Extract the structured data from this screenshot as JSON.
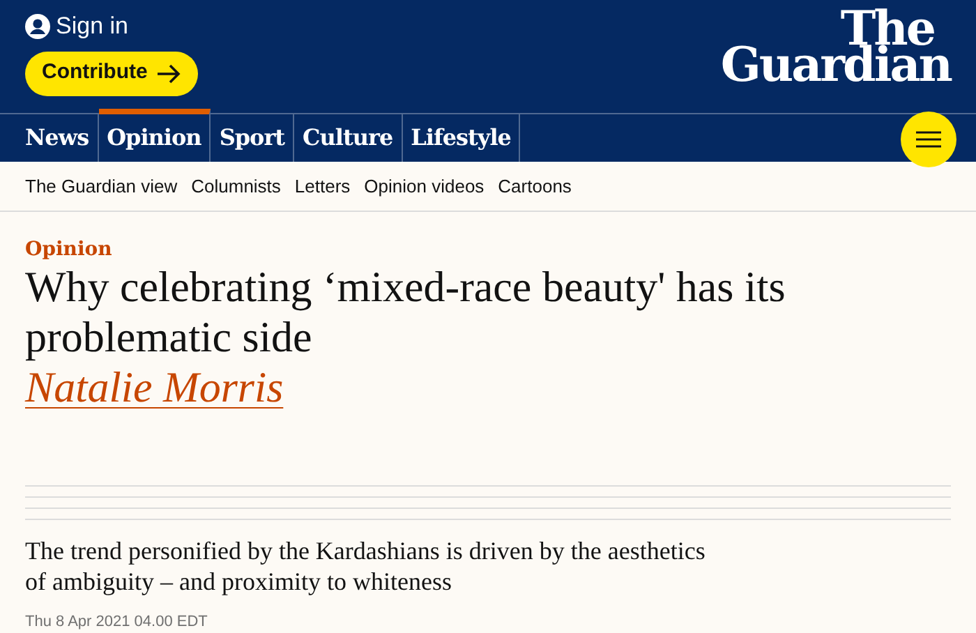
{
  "header": {
    "sign_in": "Sign in",
    "contribute": "Contribute",
    "logo": [
      "The",
      "Guardian"
    ]
  },
  "nav": [
    {
      "label": "News",
      "selected": false
    },
    {
      "label": "Opinion",
      "selected": true
    },
    {
      "label": "Sport",
      "selected": false
    },
    {
      "label": "Culture",
      "selected": false
    },
    {
      "label": "Lifestyle",
      "selected": false
    }
  ],
  "subnav": [
    "The Guardian view",
    "Columnists",
    "Letters",
    "Opinion videos",
    "Cartoons"
  ],
  "article": {
    "section": "Opinion",
    "headline": "Why celebrating ‘mixed-race beauty' has its problematic side",
    "byline": "Natalie Morris",
    "standfirst": "The trend personified by the Kardashians is driven by the aesthetics of ambiguity – and proximity to whiteness",
    "date": "Thu 8 Apr 2021 04.00 EDT"
  }
}
